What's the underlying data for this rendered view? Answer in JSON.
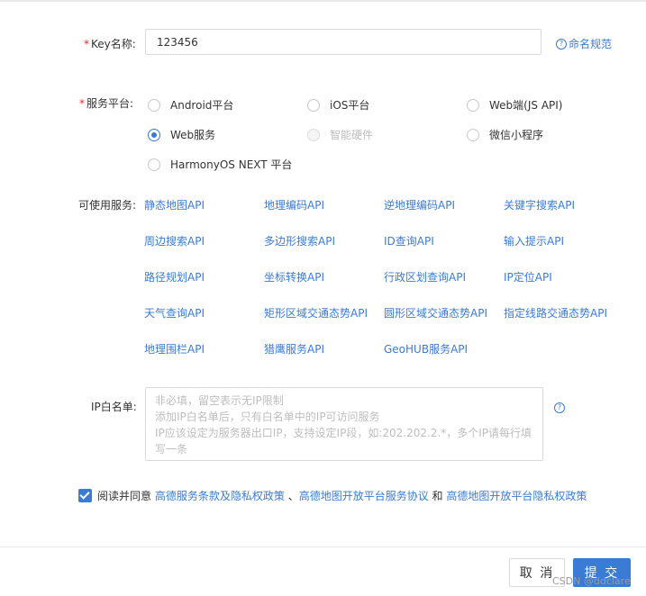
{
  "key_name": {
    "label": "Key名称:",
    "value": "123456",
    "help_link": "命名规范"
  },
  "service_platform": {
    "label": "服务平台:",
    "options": [
      {
        "label": "Android平台",
        "state": "unchecked"
      },
      {
        "label": "iOS平台",
        "state": "unchecked"
      },
      {
        "label": "Web端(JS API)",
        "state": "unchecked"
      },
      {
        "label": "Web服务",
        "state": "checked"
      },
      {
        "label": "智能硬件",
        "state": "disabled"
      },
      {
        "label": "微信小程序",
        "state": "unchecked"
      },
      {
        "label": "HarmonyOS NEXT 平台",
        "state": "unchecked"
      }
    ]
  },
  "available_services": {
    "label": "可使用服务:",
    "items": [
      "静态地图API",
      "地理编码API",
      "逆地理编码API",
      "关键字搜索API",
      "周边搜索API",
      "多边形搜索API",
      "ID查询API",
      "输入提示API",
      "路径规划API",
      "坐标转换API",
      "行政区划查询API",
      "IP定位API",
      "天气查询API",
      "矩形区域交通态势API",
      "圆形区域交通态势API",
      "指定线路交通态势API",
      "地理围栏API",
      "猎鹰服务API",
      "GeoHUB服务API"
    ]
  },
  "ip_whitelist": {
    "label": "IP白名单:",
    "placeholder": "非必填，留空表示无IP限制\n添加IP白名单后，只有白名单中的IP可访问服务\nIP应该设定为服务器出口IP，支持设定IP段，如:202.202.2.*，多个IP请每行填写一条"
  },
  "agreement": {
    "prefix": "阅读并同意",
    "link1": "高德服务条款及隐私权政策",
    "sep": "、",
    "link2": "高德地图开放平台服务协议",
    "and": "和",
    "link3": "高德地图开放平台隐私权政策",
    "checked": true
  },
  "buttons": {
    "cancel": "取 消",
    "submit": "提 交"
  },
  "watermark": "CSDN @ddclare",
  "colors": {
    "accent": "#3a7bd5",
    "required": "#f5222d"
  }
}
